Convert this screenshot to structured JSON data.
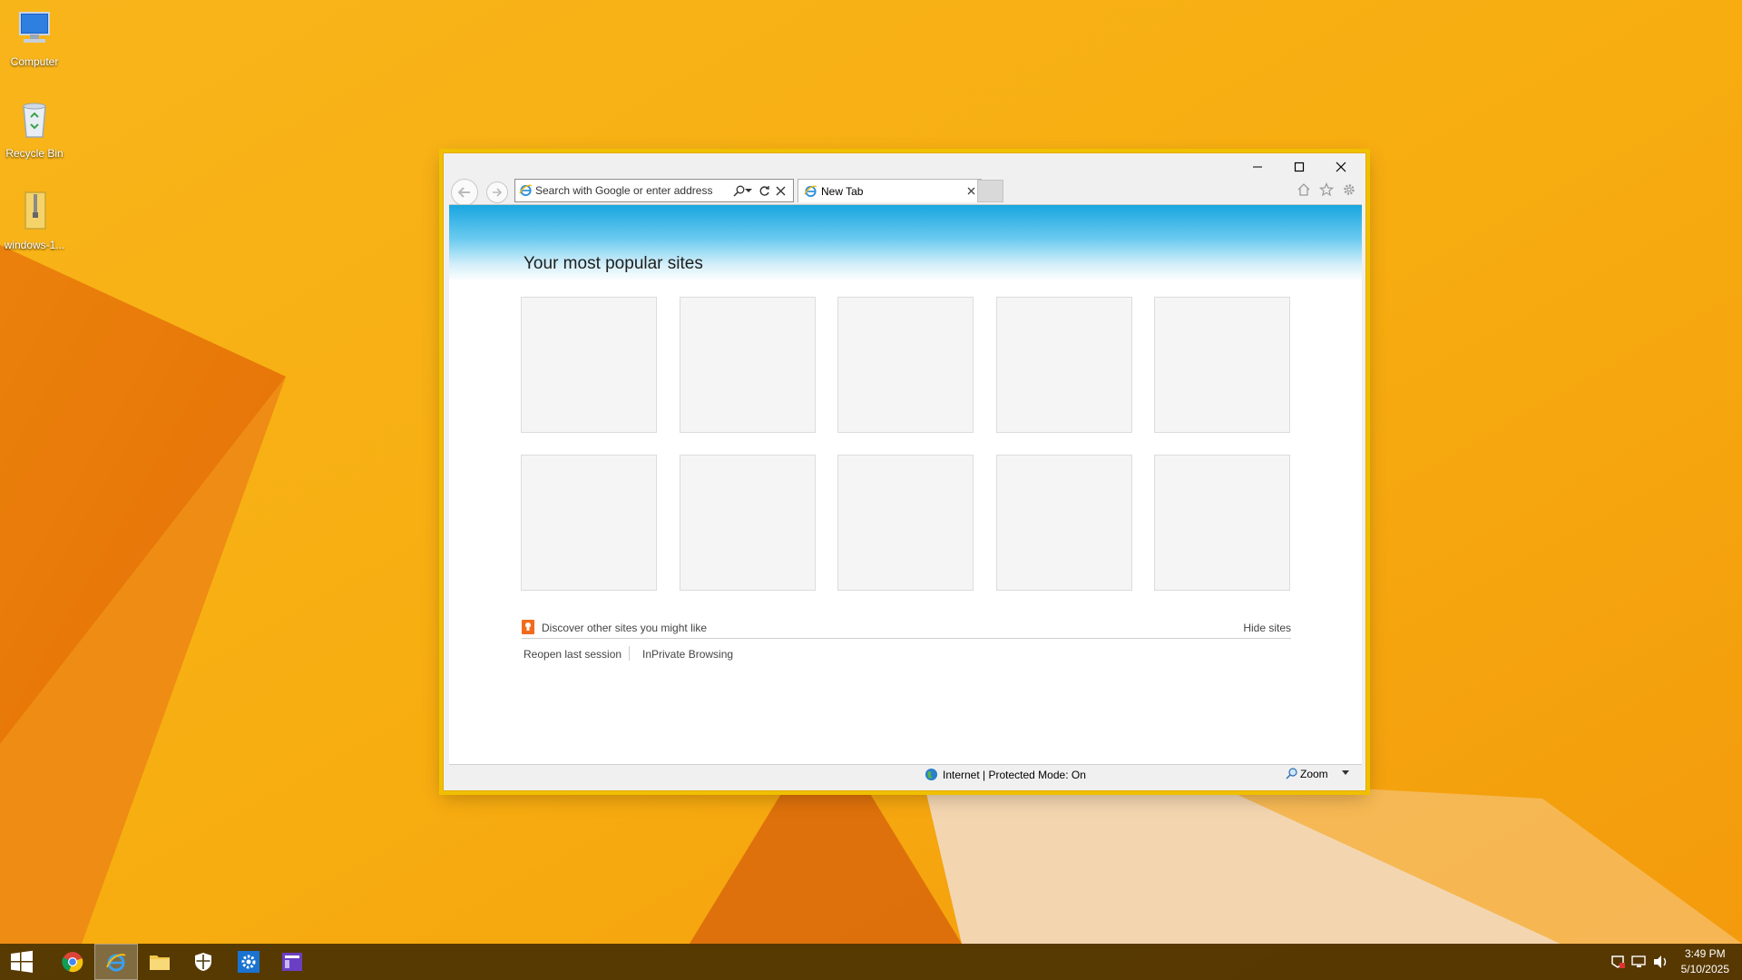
{
  "desktop": {
    "icons": [
      {
        "label": "Computer",
        "icon": "computer-icon"
      },
      {
        "label": "Recycle Bin",
        "icon": "recycle-bin-icon"
      },
      {
        "label": "windows-1...",
        "icon": "zip-folder-icon"
      }
    ]
  },
  "browser": {
    "app": "Internet Explorer",
    "address": {
      "placeholder": "Search with Google or enter address",
      "value": ""
    },
    "tabs": [
      {
        "label": "New Tab",
        "active": true
      }
    ],
    "page": {
      "title": "Your most popular sites",
      "tile_count": 10,
      "discover_label": "Discover other sites you might like",
      "hide_sites_label": "Hide sites",
      "reopen_label": "Reopen last session",
      "inprivate_label": "InPrivate Browsing"
    },
    "status": {
      "zone_text": "Internet | Protected Mode: On",
      "zoom_label": "Zoom"
    }
  },
  "taskbar": {
    "pinned": [
      {
        "name": "start-button",
        "icon": "windows-logo-icon"
      },
      {
        "name": "chrome",
        "icon": "chrome-icon"
      },
      {
        "name": "internet-explorer",
        "icon": "internet-explorer-icon",
        "active": true
      },
      {
        "name": "file-explorer",
        "icon": "folder-icon"
      },
      {
        "name": "security",
        "icon": "shield-icon"
      },
      {
        "name": "settings",
        "icon": "gear-icon"
      },
      {
        "name": "app",
        "icon": "purple-app-icon"
      }
    ],
    "tray": [
      "action-center-icon",
      "network-icon",
      "volume-icon"
    ],
    "clock": {
      "time": "3:49 PM",
      "date": "5/10/2025"
    }
  },
  "colors": {
    "wallpaper": "#f6b212",
    "window_border": "#f0c000",
    "banner_top": "#19a6e0",
    "taskbar": "#3c2800"
  }
}
